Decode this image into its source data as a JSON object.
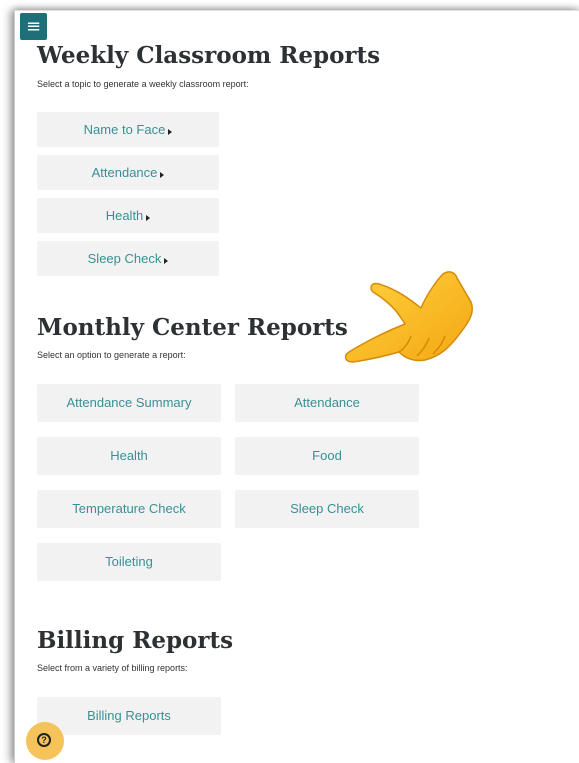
{
  "menu_icon": "hamburger-menu-icon",
  "weekly": {
    "title": "Weekly Classroom Reports",
    "subtitle": "Select a topic to generate a weekly classroom report:",
    "buttons": [
      "Name to Face",
      "Attendance",
      "Health",
      "Sleep Check"
    ]
  },
  "monthly": {
    "title": "Monthly Center Reports",
    "subtitle": "Select an option to generate a report:",
    "buttons": [
      "Attendance Summary",
      "Attendance",
      "Health",
      "Food",
      "Temperature Check",
      "Sleep Check",
      "Toileting"
    ]
  },
  "billing": {
    "title": "Billing Reports",
    "subtitle": "Select from a variety of billing reports:",
    "buttons": [
      "Billing Reports"
    ]
  },
  "overlay": {
    "pointer_icon": "pointing-hand-icon",
    "help_icon": "help-question-icon"
  },
  "colors": {
    "accent": "#1f6f78",
    "link": "#3a8f95",
    "button_bg": "#f2f2f2",
    "help": "#f6c35b"
  }
}
